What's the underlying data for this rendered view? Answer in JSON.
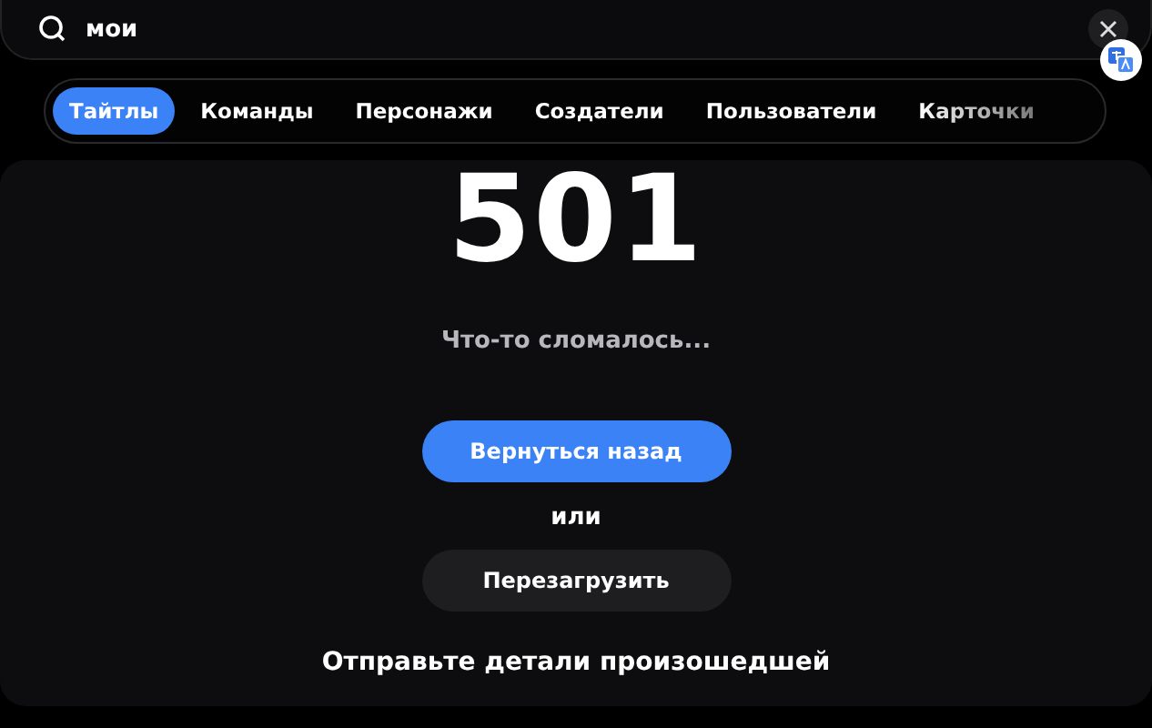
{
  "search": {
    "value": "мои"
  },
  "tabs": [
    {
      "label": "Тайтлы",
      "selected": true
    },
    {
      "label": "Команды",
      "selected": false
    },
    {
      "label": "Персонажи",
      "selected": false
    },
    {
      "label": "Создатели",
      "selected": false
    },
    {
      "label": "Пользователи",
      "selected": false
    },
    {
      "label": "Карточки",
      "selected": false
    }
  ],
  "error": {
    "code": "501",
    "message": "Что-то сломалось...",
    "primary_button": "Вернуться назад",
    "separator": "или",
    "secondary_button": "Перезагрузить",
    "details": "Отправьте детали произошедшей"
  }
}
